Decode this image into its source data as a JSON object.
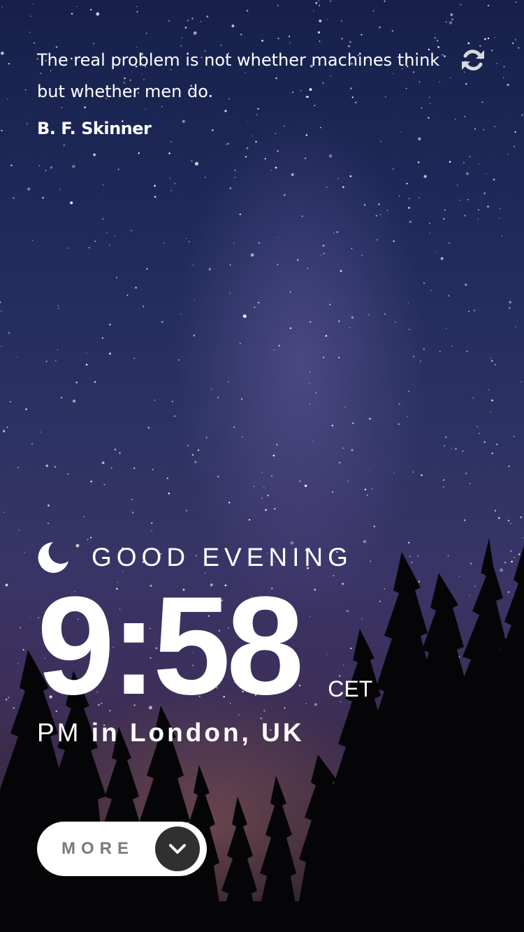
{
  "quote": {
    "text": "The real problem is not whether machines think but whether men do.",
    "author": "B. F. Skinner",
    "refresh_icon": "refresh-icon"
  },
  "greeting": {
    "icon": "moon-icon",
    "text": "GOOD EVENING"
  },
  "clock": {
    "time": "9:58",
    "timezone": "CET",
    "ampm": "PM",
    "location": "in London, UK"
  },
  "more_button": {
    "label": "MORE",
    "icon": "chevron-down-icon"
  },
  "colors": {
    "text": "#ffffff",
    "button_bg": "#ffffff",
    "button_label": "#7a7a7a",
    "chevron_circle": "#303030"
  }
}
